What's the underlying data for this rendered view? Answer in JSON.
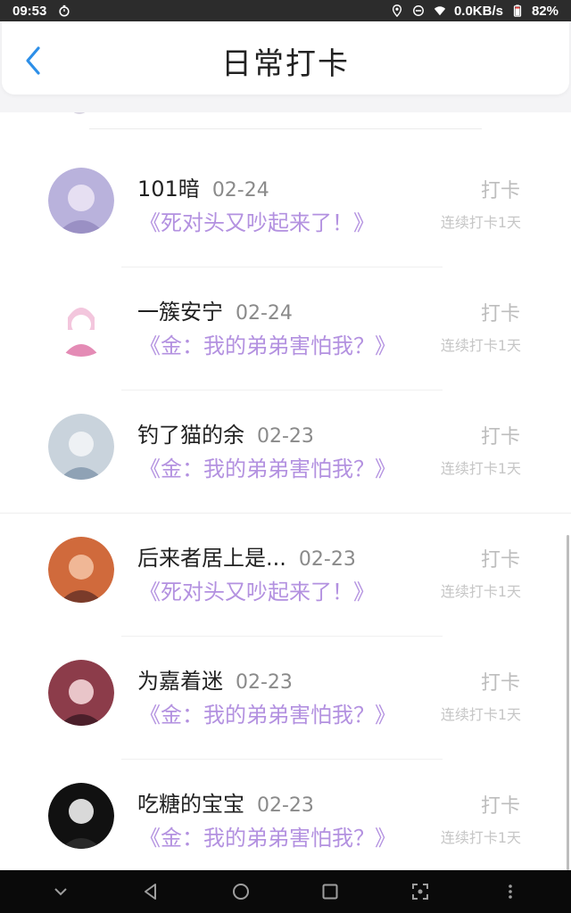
{
  "status_bar": {
    "time": "09:53",
    "network_speed": "0.0KB/s",
    "battery": "82%"
  },
  "header": {
    "title": "日常打卡",
    "back_icon": "chevron-left-icon"
  },
  "entries": [
    {
      "name": "101暗",
      "date": "02-24",
      "book": "《死对头又吵起来了！》",
      "action": "打卡",
      "streak": "连续打卡1天",
      "avatar_colors": [
        "#b9b2dc",
        "#e6dff2",
        "#9a90c4"
      ]
    },
    {
      "name": "一簇安宁",
      "date": "02-24",
      "book": "《金：我的弟弟害怕我？》",
      "action": "打卡",
      "streak": "连续打卡1天",
      "avatar_colors": [
        "#f3c6dd",
        "#ffffff",
        "#e48bb5"
      ]
    },
    {
      "name": "钓了猫的余",
      "date": "02-23",
      "book": "《金：我的弟弟害怕我？》",
      "action": "打卡",
      "streak": "连续打卡1天",
      "avatar_colors": [
        "#c9d3dc",
        "#eef1f4",
        "#8fa2b5"
      ]
    },
    {
      "name": "后来者居上是...",
      "date": "02-23",
      "book": "《死对头又吵起来了！》",
      "action": "打卡",
      "streak": "连续打卡1天",
      "avatar_colors": [
        "#d06a3c",
        "#f0b796",
        "#7a3b2a"
      ]
    },
    {
      "name": "为嘉着迷",
      "date": "02-23",
      "book": "《金：我的弟弟害怕我？》",
      "action": "打卡",
      "streak": "连续打卡1天",
      "avatar_colors": [
        "#8c3c4a",
        "#e9c5c9",
        "#4b1f2a"
      ]
    },
    {
      "name": "吃糖的宝宝",
      "date": "02-23",
      "book": "《金：我的弟弟害怕我？》",
      "action": "打卡",
      "streak": "连续打卡1天",
      "avatar_colors": [
        "#2a2a2a",
        "#d9d9d9",
        "#111111"
      ]
    }
  ],
  "nav_bar": {
    "icons": [
      "chevron-down-icon",
      "back-triangle-icon",
      "home-circle-icon",
      "recents-square-icon",
      "screenshot-icon",
      "more-dots-icon"
    ]
  }
}
